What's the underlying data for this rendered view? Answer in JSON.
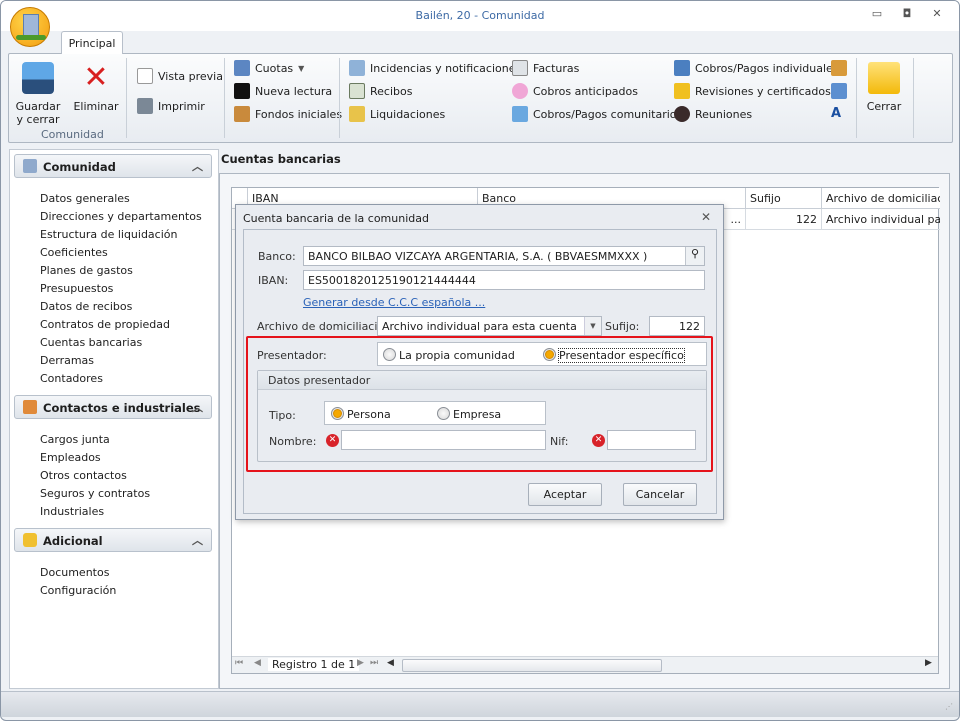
{
  "window": {
    "title": "Bailén, 20 - Comunidad"
  },
  "ribbon": {
    "tab": "Principal",
    "group_label": "Comunidad",
    "guardar": "Guardar y cerrar",
    "eliminar": "Eliminar",
    "vista_previa": "Vista previa",
    "imprimir": "Imprimir",
    "cuotas": "Cuotas",
    "nueva_lectura": "Nueva lectura",
    "fondos_iniciales": "Fondos iniciales",
    "incidencias": "Incidencias y notificaciones",
    "recibos": "Recibos",
    "liquidaciones": "Liquidaciones",
    "facturas": "Facturas",
    "cobros_anticipados": "Cobros anticipados",
    "cobros_pagos_comunitarios": "Cobros/Pagos comunitarios",
    "cobros_pagos_individuales": "Cobros/Pagos individuales",
    "revisiones": "Revisiones y certificados",
    "reuniones": "Reuniones",
    "cerrar": "Cerrar"
  },
  "sidebar": {
    "sections": [
      {
        "title": "Comunidad",
        "items": [
          "Datos generales",
          "Direcciones y departamentos",
          "Estructura de liquidación",
          "Coeficientes",
          "Planes de gastos",
          "Presupuestos",
          "Datos de recibos",
          "Contratos de propiedad",
          "Cuentas bancarias",
          "Derramas",
          "Contadores"
        ]
      },
      {
        "title": "Contactos e industriales",
        "items": [
          "Cargos junta",
          "Empleados",
          "Otros contactos",
          "Seguros y contratos",
          "Industriales"
        ]
      },
      {
        "title": "Adicional",
        "items": [
          "Documentos",
          "Configuración"
        ]
      }
    ]
  },
  "main": {
    "title": "Cuentas bancarias",
    "columns": [
      "IBAN",
      "Banco",
      "Sufijo",
      "Archivo de domiciliación"
    ],
    "row": {
      "banco_trunc": "...",
      "sufijo": "122",
      "archivo": "Archivo individual para esta cuenta"
    },
    "nav_text": "Registro 1 de 1"
  },
  "dialog": {
    "title": "Cuenta bancaria de la comunidad",
    "banco_label": "Banco:",
    "banco_value": "BANCO BILBAO VIZCAYA ARGENTARIA, S.A. ( BBVAESMMXXX )",
    "iban_label": "IBAN:",
    "iban_value": "ES5001820125190121444444",
    "generate_link": "Generar desde C.C.C española ...",
    "archivo_label": "Archivo de domiciliación:",
    "archivo_value": "Archivo individual para esta cuenta",
    "sufijo_label": "Sufijo:",
    "sufijo_value": "122",
    "presentador_label": "Presentador:",
    "presentador_options": [
      "La propia comunidad",
      "Presentador específico"
    ],
    "datos_presentador": "Datos presentador",
    "tipo_label": "Tipo:",
    "tipo_options": [
      "Persona",
      "Empresa"
    ],
    "nombre_label": "Nombre:",
    "nombre_value": "",
    "nif_label": "Nif:",
    "nif_value": "",
    "aceptar": "Aceptar",
    "cancelar": "Cancelar"
  },
  "colors": {
    "accent": "#3d6aa5",
    "highlight": "#e5131b",
    "radio_selected": "#f5a800"
  }
}
